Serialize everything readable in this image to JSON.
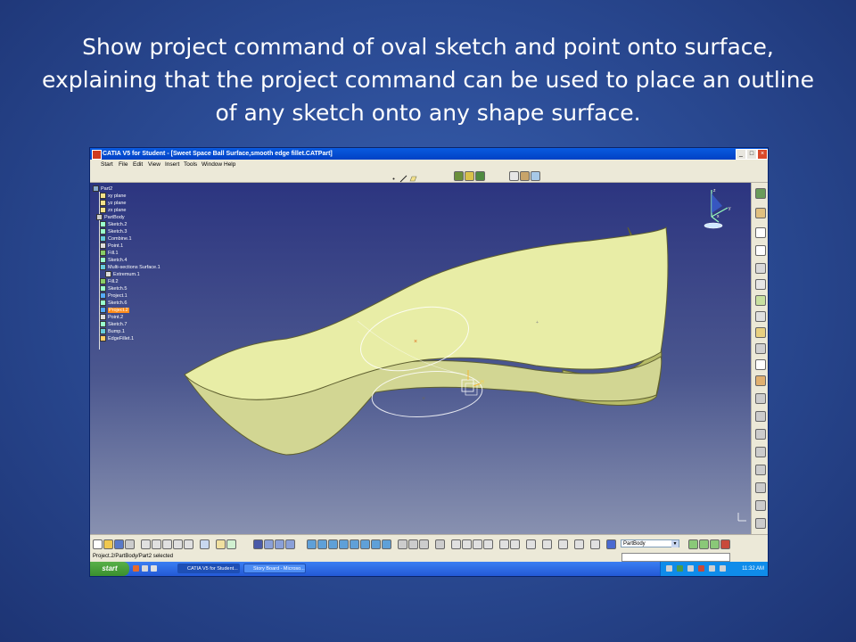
{
  "slide": {
    "caption": "Show project command of oval sketch and point onto surface, explaining that the project  command can be used to place an outline of any sketch onto any shape surface."
  },
  "window": {
    "title": "CATIA V5 for Student - [Sweet Space Ball Surface,smooth edge fillet.CATPart]"
  },
  "menu": [
    "Start",
    "File",
    "Edit",
    "View",
    "Insert",
    "Tools",
    "Window",
    "Help"
  ],
  "tree": [
    {
      "label": "Part2"
    },
    {
      "label": "xy plane"
    },
    {
      "label": "yz plane"
    },
    {
      "label": "zx plane"
    },
    {
      "label": "PartBody"
    },
    {
      "label": "Sketch.2"
    },
    {
      "label": "Sketch.3"
    },
    {
      "label": "Combine.1"
    },
    {
      "label": "Point.1"
    },
    {
      "label": "Fill.1"
    },
    {
      "label": "Sketch.4"
    },
    {
      "label": "Multi-sections Surface.1"
    },
    {
      "label": "Extremum.1"
    },
    {
      "label": "Fill.2"
    },
    {
      "label": "Sketch.5"
    },
    {
      "label": "Project.1"
    },
    {
      "label": "Sketch.6"
    },
    {
      "label": "Project.2",
      "selected": true
    },
    {
      "label": "Point.2"
    },
    {
      "label": "Sketch.7"
    },
    {
      "label": "Bump.1"
    },
    {
      "label": "EdgeFillet.1"
    }
  ],
  "toolbar": {
    "active_body": "PartBody"
  },
  "status": {
    "text": "Project.2/PartBody/Part2 selected"
  },
  "taskbar": {
    "start_label": "start",
    "tasks": [
      "CATIA V5 for Student...",
      "Story Board - Microso..."
    ],
    "clock": "11:32 AM"
  },
  "colors": {
    "surface_fill": "#e8eda6",
    "surface_side": "#b7bc68",
    "selected_highlight": "#ff8c1a",
    "titlebar_blue": "#0a5be0"
  }
}
